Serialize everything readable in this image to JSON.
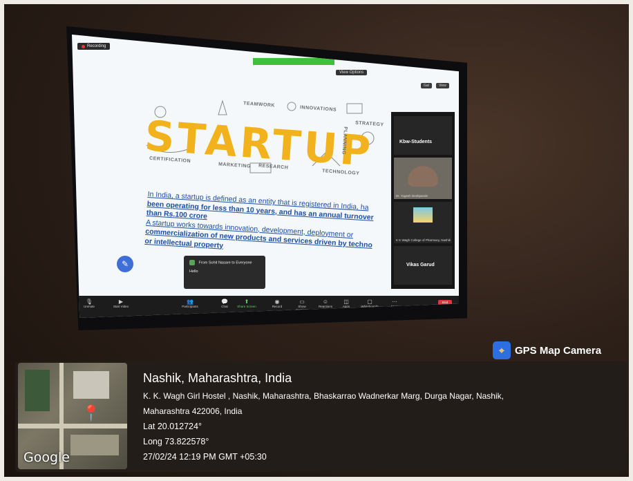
{
  "meeting": {
    "recording_label": "Recording",
    "view_label": "View Options",
    "mini_buttons": [
      "Gal",
      "View"
    ],
    "slide": {
      "headline": "STARTUP",
      "doodles": [
        "TEAMWORK",
        "INNOVATIONS",
        "STRATEGY",
        "CERTIFICATION",
        "MARKETING",
        "RESEARCH",
        "TECHNOLOGY",
        "PLANNING"
      ],
      "paragraph1_a": "In India, a startup is defined as an entity that is registered in India, ha",
      "paragraph1_b": "been operating for less than 10 years, and has an annual turnover",
      "paragraph1_c": "than Rs.100 crore",
      "paragraph2_a": "A startup works towards innovation, development, deployment or",
      "paragraph2_b": "commercialization of new products and services driven by techno",
      "paragraph2_c": "or intellectual property"
    },
    "chat_popup": {
      "from": "From Sohit Nasare to Everyone",
      "message": "Hello"
    },
    "participants": [
      {
        "name": "Kbw-Students"
      },
      {
        "name": "Dr. Yogesh Deshpande"
      },
      {
        "name": "K K Wagh College of Pharmacy, Nashik"
      },
      {
        "name": "Vikas Garud"
      }
    ],
    "toolbar": [
      {
        "label": "Unmute",
        "icon": "microphone-icon"
      },
      {
        "label": "Start Video",
        "icon": "video-icon"
      },
      {
        "label": "Participants",
        "icon": "participants-icon"
      },
      {
        "label": "Chat",
        "icon": "chat-icon"
      },
      {
        "label": "Share Screen",
        "icon": "share-screen-icon"
      },
      {
        "label": "Record",
        "icon": "record-icon"
      },
      {
        "label": "Show Captions",
        "icon": "captions-icon"
      },
      {
        "label": "Reactions",
        "icon": "reactions-icon"
      },
      {
        "label": "Apps",
        "icon": "apps-icon"
      },
      {
        "label": "Whiteboards",
        "icon": "whiteboard-icon"
      },
      {
        "label": "More",
        "icon": "more-icon"
      }
    ],
    "end_label": "End"
  },
  "gps": {
    "app_name": "GPS Map Camera",
    "city": "Nashik, Maharashtra, India",
    "address_line1": "K. K. Wagh Girl Hostel , Nashik, Maharashtra, Bhaskarrao Wadnerkar Marg, Durga Nagar, Nashik,",
    "address_line2": "Maharashtra 422006, India",
    "lat": "Lat 20.012724°",
    "long": "Long 73.822578°",
    "timestamp": "27/02/24 12:19 PM GMT +05:30",
    "map_watermark": "Google"
  }
}
